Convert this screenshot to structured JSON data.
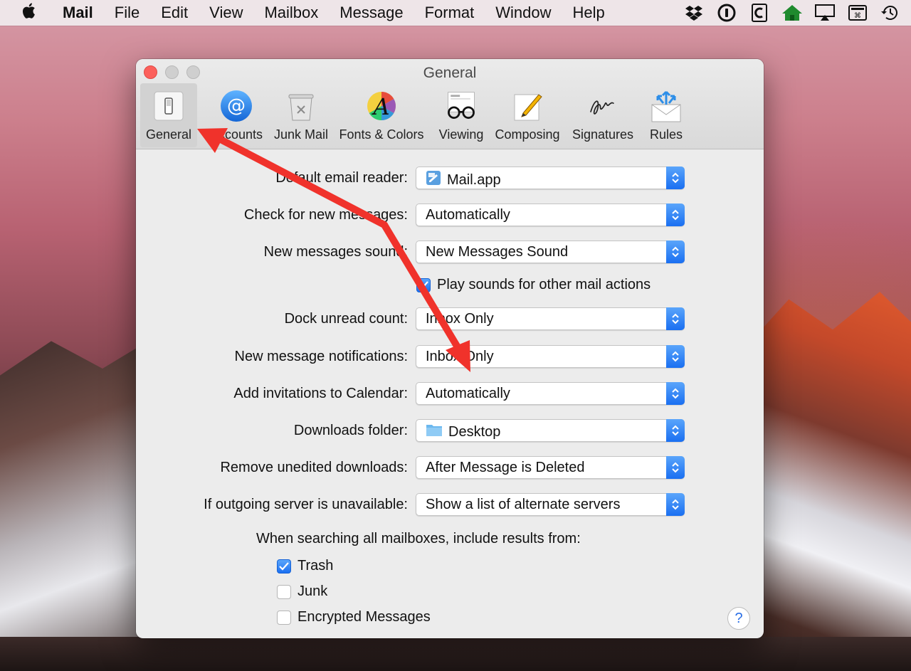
{
  "menubar": {
    "app": "Mail",
    "items": [
      "File",
      "Edit",
      "View",
      "Mailbox",
      "Message",
      "Format",
      "Window",
      "Help"
    ],
    "status_icons": [
      "dropbox-icon",
      "1password-icon",
      "clipboard-icon",
      "home-icon",
      "airplay-icon",
      "keyboard-viewer-icon",
      "time-machine-icon"
    ]
  },
  "window": {
    "title": "General"
  },
  "toolbar": {
    "tabs": [
      {
        "label": "General",
        "icon": "general-switch-icon"
      },
      {
        "label": "Accounts",
        "icon": "at-sign-icon"
      },
      {
        "label": "Junk Mail",
        "icon": "trash-bin-icon"
      },
      {
        "label": "Fonts & Colors",
        "icon": "color-wheel-icon"
      },
      {
        "label": "Viewing",
        "icon": "glasses-icon"
      },
      {
        "label": "Composing",
        "icon": "pencil-paper-icon"
      },
      {
        "label": "Signatures",
        "icon": "signature-icon"
      },
      {
        "label": "Rules",
        "icon": "envelope-arrows-icon"
      }
    ],
    "selected": "General"
  },
  "settings": {
    "default_reader": {
      "label": "Default email reader:",
      "value": "Mail.app"
    },
    "check_new": {
      "label": "Check for new messages:",
      "value": "Automatically"
    },
    "new_sound": {
      "label": "New messages sound:",
      "value": "New Messages Sound"
    },
    "play_sounds": {
      "label": "Play sounds for other mail actions",
      "checked": true
    },
    "dock_unread": {
      "label": "Dock unread count:",
      "value": "Inbox Only"
    },
    "notifications": {
      "label": "New message notifications:",
      "value": "Inbox Only"
    },
    "invitations": {
      "label": "Add invitations to Calendar:",
      "value": "Automatically"
    },
    "downloads_folder": {
      "label": "Downloads folder:",
      "value": "Desktop"
    },
    "remove_downloads": {
      "label": "Remove unedited downloads:",
      "value": "After Message is Deleted"
    },
    "outgoing_server": {
      "label": "If outgoing server is unavailable:",
      "value": "Show a list of alternate servers"
    }
  },
  "search": {
    "heading": "When searching all mailboxes, include results from:",
    "options": [
      {
        "label": "Trash",
        "checked": true
      },
      {
        "label": "Junk",
        "checked": false
      },
      {
        "label": "Encrypted Messages",
        "checked": false
      }
    ]
  },
  "help": {
    "label": "?"
  },
  "colors": {
    "accent": "#1a6ff1",
    "annotation_arrow": "#f0322b",
    "close_button": "#fc605b"
  }
}
